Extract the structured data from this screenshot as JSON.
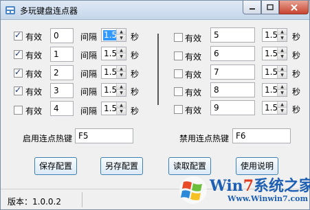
{
  "window": {
    "title": "多玩键盘连点器"
  },
  "rows_left": [
    {
      "checked": true,
      "label": "有效",
      "key": "0",
      "interval_label": "间隔",
      "interval": "1.5",
      "unit": "秒"
    },
    {
      "checked": true,
      "label": "有效",
      "key": "1",
      "interval_label": "间隔",
      "interval": "1.5",
      "unit": "秒"
    },
    {
      "checked": true,
      "label": "有效",
      "key": "2",
      "interval_label": "间隔",
      "interval": "1.5",
      "unit": "秒"
    },
    {
      "checked": true,
      "label": "有效",
      "key": "3",
      "interval_label": "间隔",
      "interval": "1.5",
      "unit": "秒"
    },
    {
      "checked": false,
      "label": "有效",
      "key": "4",
      "interval_label": "间隔",
      "interval": "1.5",
      "unit": "秒"
    }
  ],
  "rows_right": [
    {
      "checked": false,
      "label": "有效",
      "key": "5",
      "interval": "1.5",
      "unit": "秒"
    },
    {
      "checked": false,
      "label": "有效",
      "key": "6",
      "interval": "1.5",
      "unit": "秒"
    },
    {
      "checked": false,
      "label": "有效",
      "key": "7",
      "interval": "1.5",
      "unit": "秒"
    },
    {
      "checked": false,
      "label": "有效",
      "key": "8",
      "interval": "1.5",
      "unit": "秒"
    },
    {
      "checked": false,
      "label": "有效",
      "key": "9",
      "interval": "1.5",
      "unit": "秒"
    }
  ],
  "hotkeys": {
    "enable_label": "启用连点热键",
    "enable_value": "F5",
    "disable_label": "禁用连点热键",
    "disable_value": "F6"
  },
  "buttons": {
    "save": "保存配置",
    "save_as": "另存配置",
    "load": "读取配置",
    "help": "使用说明"
  },
  "status": {
    "version": "版本：1.0.0.2"
  },
  "watermark": {
    "brand_prefix": "Win",
    "brand_seven": "7",
    "brand_suffix": "系统之家",
    "url": "Www.Winwin7.com"
  },
  "colors": {
    "selection": "#3399ff",
    "brand_blue": "#1d5fb3",
    "brand_red": "#e03a1a"
  }
}
